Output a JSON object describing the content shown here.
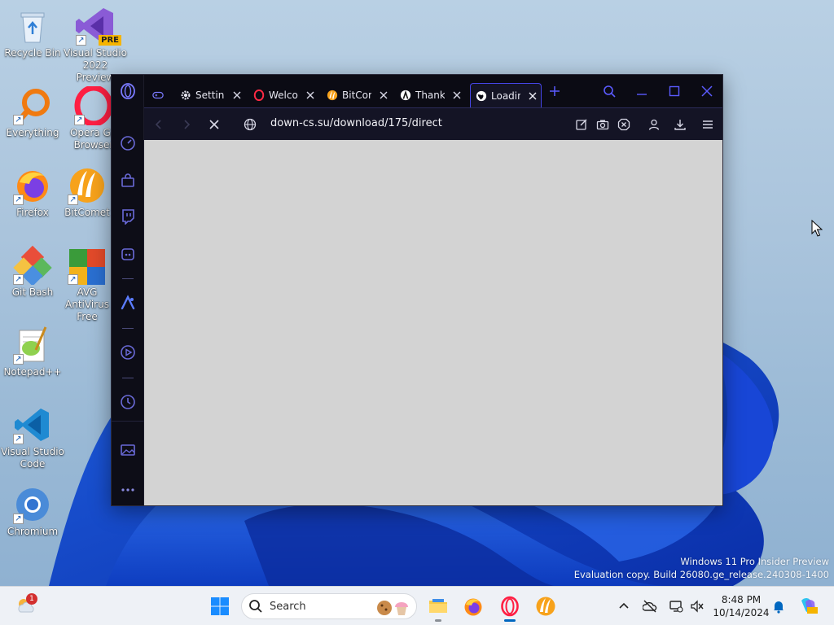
{
  "desktop": {
    "watermark": {
      "line1": "Windows 11 Pro Insider Preview",
      "line2": "Evaluation copy. Build 26080.ge_release.240308-1400"
    },
    "icons": [
      {
        "label": "Recycle Bin",
        "icon": "recycle-bin-icon"
      },
      {
        "label": "Visual Studio 2022 Preview",
        "icon": "visual-studio-preview-icon",
        "badge": "PRE"
      },
      {
        "label": "Everything",
        "icon": "everything-search-icon"
      },
      {
        "label": "Opera GX Browser",
        "icon": "opera-gx-icon"
      },
      {
        "label": "Firefox",
        "icon": "firefox-icon"
      },
      {
        "label": "BitComet",
        "icon": "bitcomet-icon"
      },
      {
        "label": "Git Bash",
        "icon": "git-bash-icon"
      },
      {
        "label": "AVG AntiVirus Free",
        "icon": "avg-antivirus-icon"
      },
      {
        "label": "Notepad++",
        "icon": "notepad-plus-plus-icon"
      },
      {
        "label": "Visual Studio Code",
        "icon": "vscode-icon"
      },
      {
        "label": "Chromium",
        "icon": "chromium-icon"
      }
    ]
  },
  "browser": {
    "tabs": [
      {
        "label": "Settings",
        "icon": "gear-icon"
      },
      {
        "label": "Welcome",
        "icon": "opera-icon"
      },
      {
        "label": "BitComet",
        "icon": "bitcomet-icon"
      },
      {
        "label": "Thank",
        "icon": "thank-icon"
      },
      {
        "label": "Loading",
        "icon": "globe-icon",
        "active": true
      }
    ],
    "url": "down-cs.su/download/175/direct",
    "accent": "#4545e6"
  },
  "taskbar": {
    "search_placeholder": "Search",
    "clock_time": "8:48 PM",
    "clock_date": "10/14/2024",
    "weather_badge": "1"
  },
  "colors": {
    "taskbar_bg": "#eef1f6",
    "browser_bg": "#0b0b14",
    "content_bg": "#d3d3d3"
  }
}
